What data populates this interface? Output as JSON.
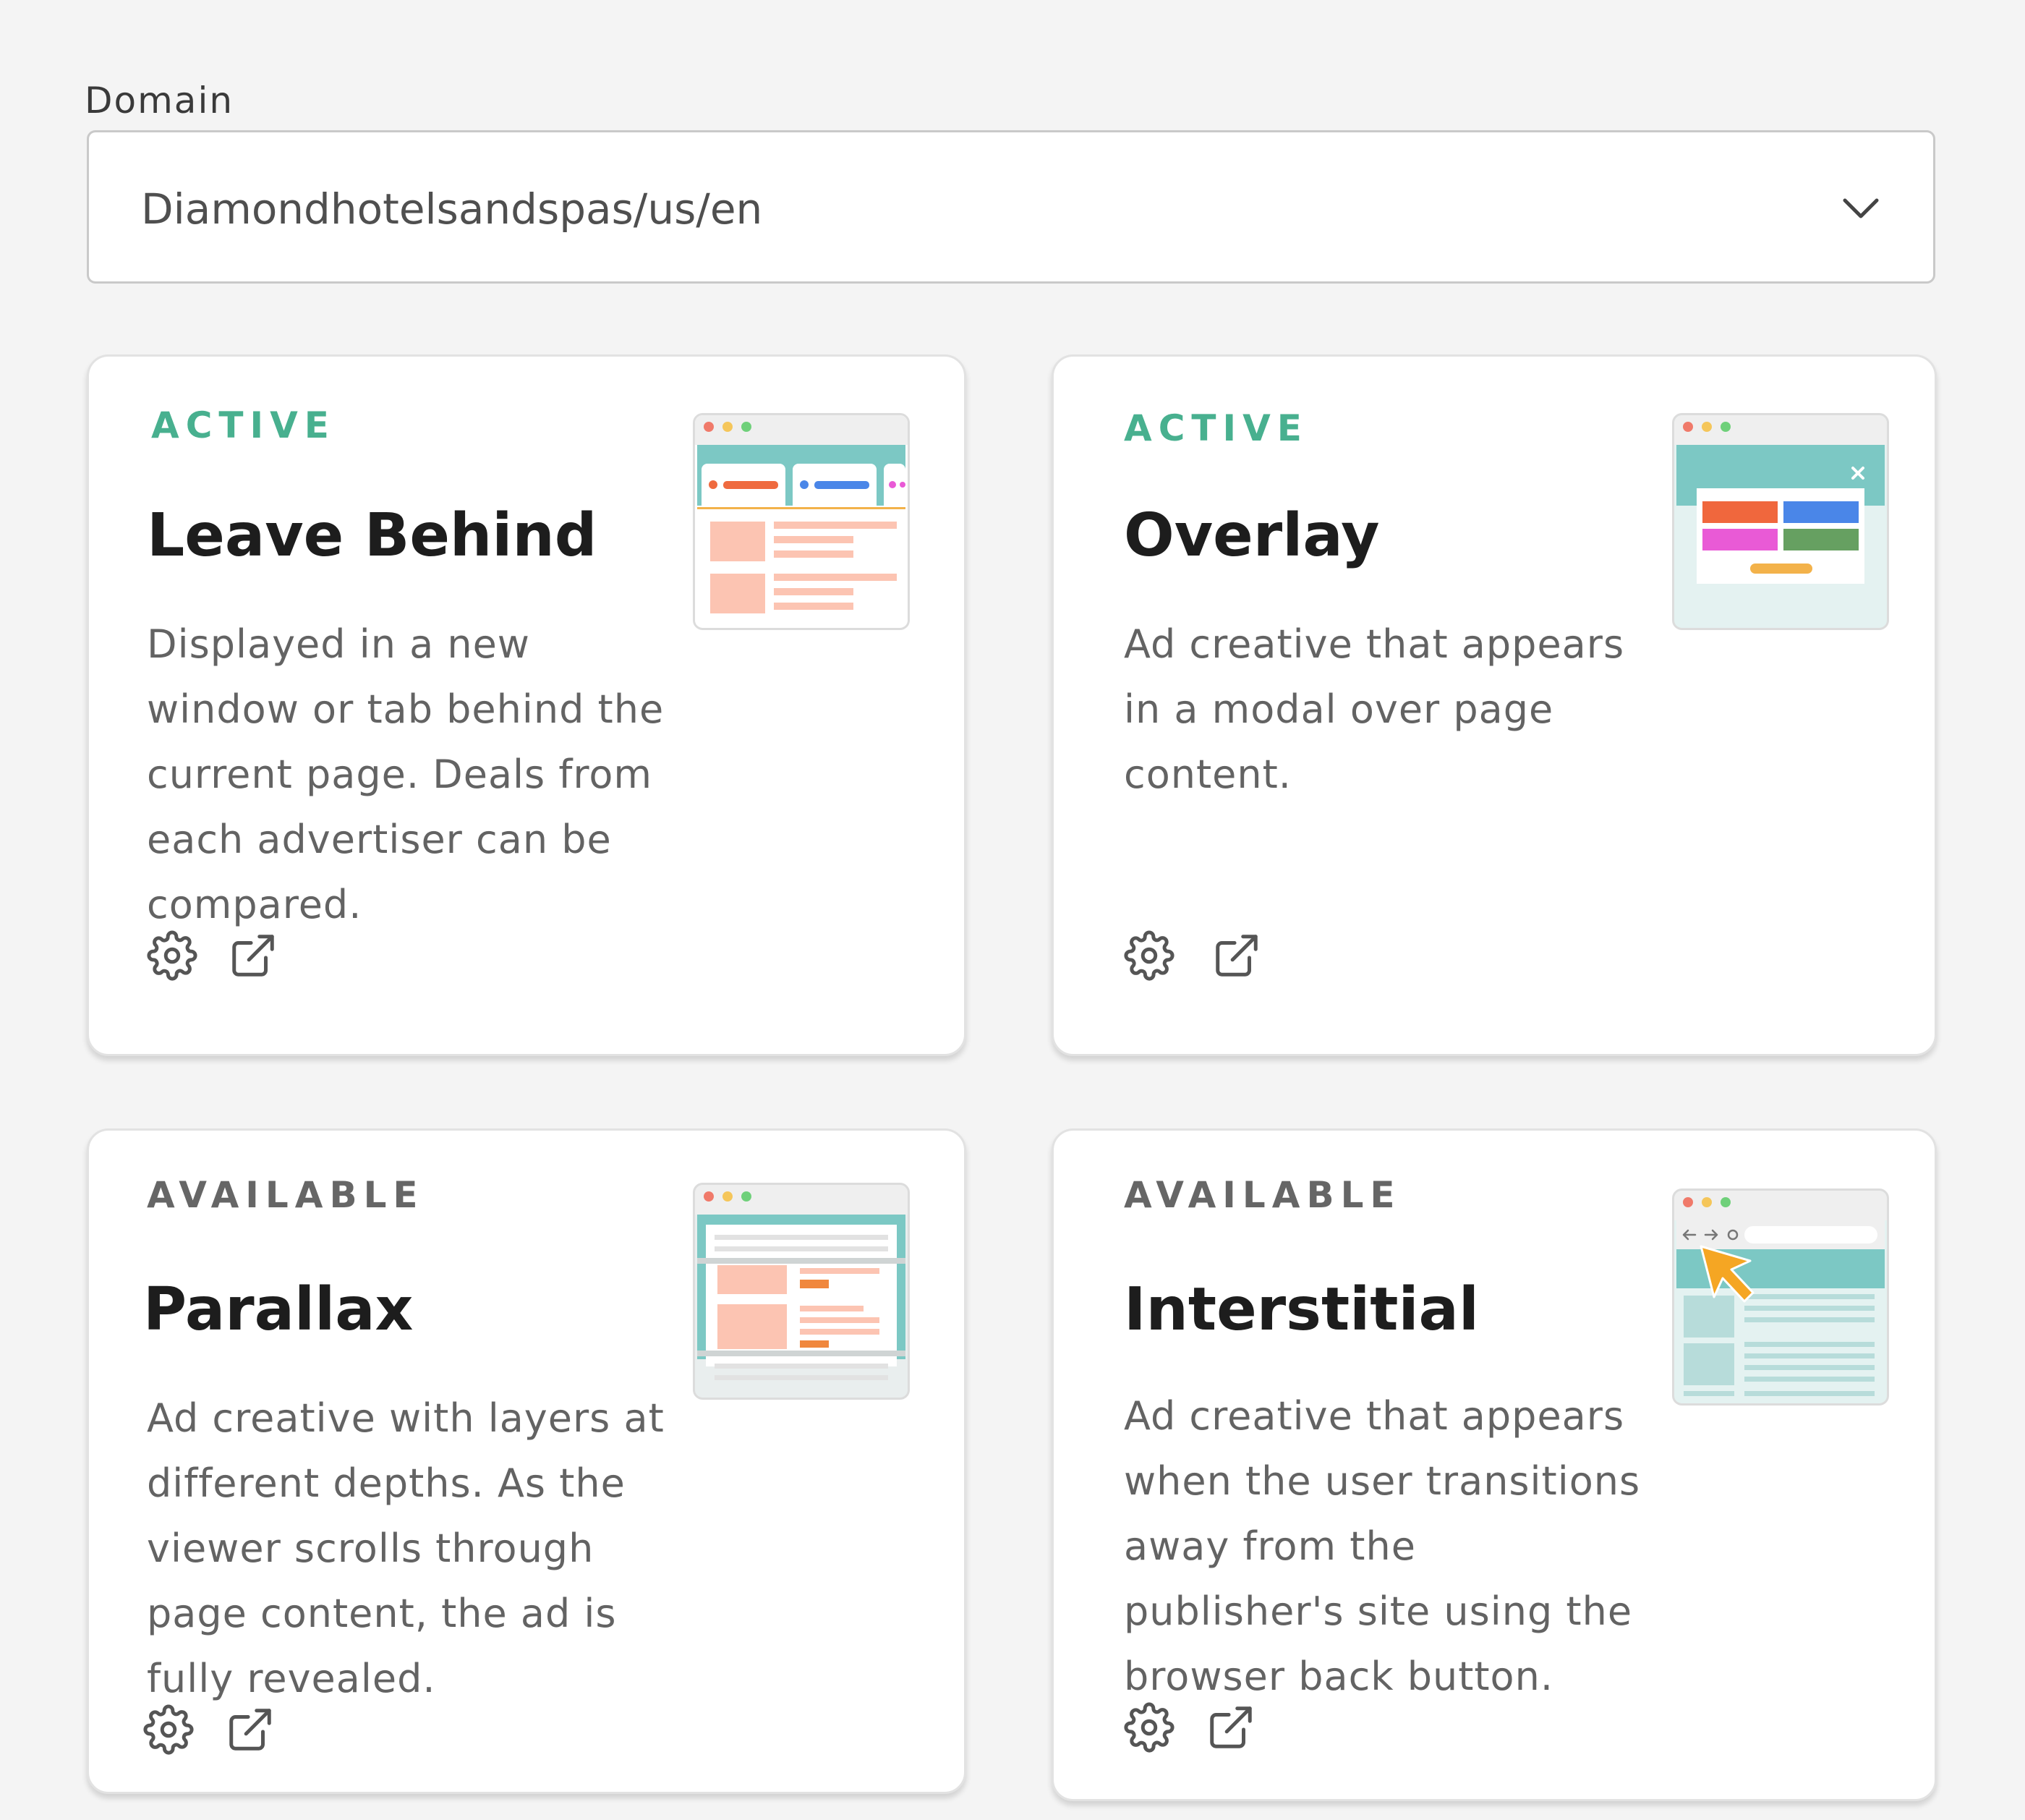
{
  "domain": {
    "label": "Domain",
    "selected": "Diamondhotelsandspas/us/en"
  },
  "colors": {
    "active": "#48b08f",
    "available": "#666666"
  },
  "cards": [
    {
      "status": "ACTIVE",
      "title": "Leave Behind",
      "description": [
        "Displayed in a new",
        "window or tab behind the",
        "current page. Deals from",
        "each advertiser can be",
        "compared."
      ],
      "thumbnail_icon": "leave-behind-thumbnail"
    },
    {
      "status": "ACTIVE",
      "title": "Overlay",
      "description": [
        "Ad creative that appears",
        "in a modal over page",
        "content."
      ],
      "thumbnail_icon": "overlay-thumbnail"
    },
    {
      "status": "AVAILABLE",
      "title": "Parallax",
      "description": [
        "Ad creative with layers at",
        "different depths. As the",
        "viewer scrolls through",
        "page content, the ad is",
        "fully revealed."
      ],
      "thumbnail_icon": "parallax-thumbnail"
    },
    {
      "status": "AVAILABLE",
      "title": "Interstitial",
      "description": [
        "Ad creative that appears",
        "when the user transitions",
        "away from the",
        "publisher's site using the",
        "browser back button."
      ],
      "thumbnail_icon": "interstitial-thumbnail"
    }
  ],
  "icons": {
    "settings": "gear-icon",
    "open": "external-link-icon"
  }
}
